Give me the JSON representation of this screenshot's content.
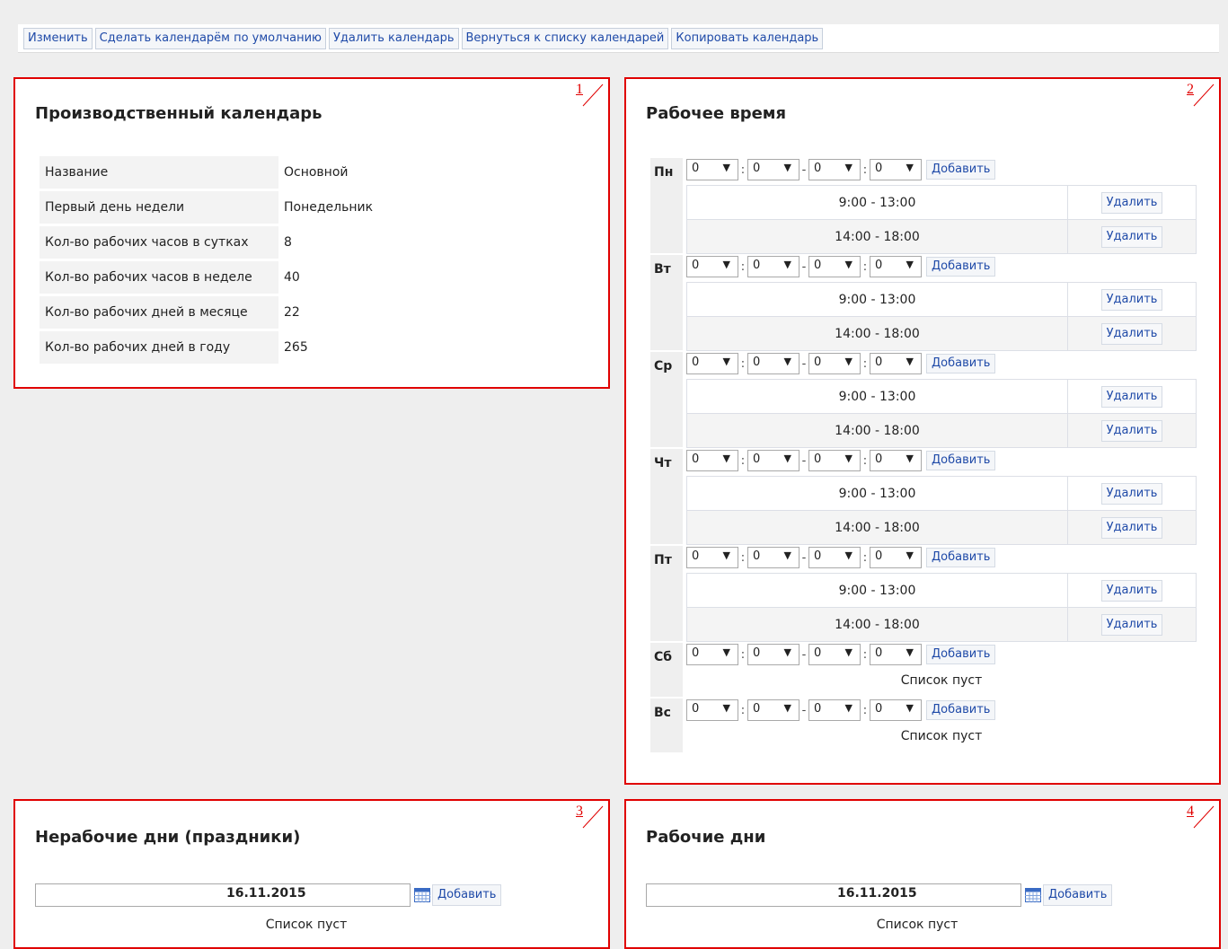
{
  "toolbar": {
    "buttons": [
      "Изменить",
      "Сделать календарём по умолчанию",
      "Удалить календарь",
      "Вернуться к списку календарей",
      "Копировать календарь"
    ]
  },
  "panels": {
    "p1": {
      "num": "1",
      "title": "Производственный календарь",
      "rows": [
        {
          "label": "Название",
          "value": "Основной"
        },
        {
          "label": "Первый день недели",
          "value": "Понедельник"
        },
        {
          "label": "Кол-во рабочих часов в сутках",
          "value": "8"
        },
        {
          "label": "Кол-во рабочих часов в неделе",
          "value": "40"
        },
        {
          "label": "Кол-во рабочих дней в месяце",
          "value": "22"
        },
        {
          "label": "Кол-во рабочих дней в году",
          "value": "265"
        }
      ]
    },
    "p2": {
      "num": "2",
      "title": "Рабочее время",
      "select_default": "0",
      "add_label": "Добавить",
      "delete_label": "Удалить",
      "empty_label": "Список пуст",
      "days": [
        {
          "label": "Пн",
          "intervals": [
            "9:00 - 13:00",
            "14:00 - 18:00"
          ]
        },
        {
          "label": "Вт",
          "intervals": [
            "9:00 - 13:00",
            "14:00 - 18:00"
          ]
        },
        {
          "label": "Ср",
          "intervals": [
            "9:00 - 13:00",
            "14:00 - 18:00"
          ]
        },
        {
          "label": "Чт",
          "intervals": [
            "9:00 - 13:00",
            "14:00 - 18:00"
          ]
        },
        {
          "label": "Пт",
          "intervals": [
            "9:00 - 13:00",
            "14:00 - 18:00"
          ]
        },
        {
          "label": "Сб",
          "intervals": []
        },
        {
          "label": "Вс",
          "intervals": []
        }
      ]
    },
    "p3": {
      "num": "3",
      "title": "Нерабочие дни (праздники)",
      "date": "16.11.2015",
      "add_label": "Добавить",
      "empty_label": "Список пуст"
    },
    "p4": {
      "num": "4",
      "title": "Рабочие дни",
      "date": "16.11.2015",
      "add_label": "Добавить",
      "empty_label": "Список пуст"
    }
  },
  "colors": {
    "accent_border": "#e00000",
    "link": "#1f4aa8",
    "background": "#eeeeee"
  }
}
